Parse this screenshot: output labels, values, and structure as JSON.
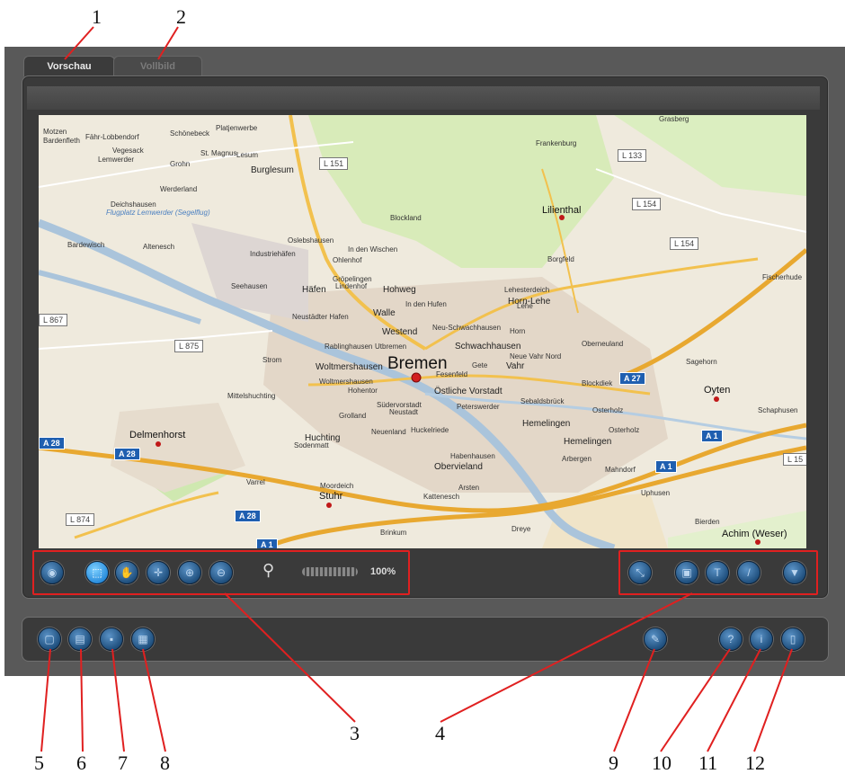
{
  "tabs": [
    {
      "label": "Vorschau",
      "active": true
    },
    {
      "label": "Vollbild",
      "active": false
    }
  ],
  "callouts": [
    "1",
    "2",
    "3",
    "4",
    "5",
    "6",
    "7",
    "8",
    "9",
    "10",
    "11",
    "12"
  ],
  "map": {
    "labels": {
      "bremen": "Bremen",
      "delmenhorst": "Delmenhorst",
      "lilienthal": "Lilienthal",
      "oyten": "Oyten",
      "achim": "Achim (Weser)",
      "stuhr": "Stuhr",
      "burglesum": "Burglesum",
      "blockland": "Blockland",
      "frankenburg": "Frankenburg",
      "grasberg": "Grasberg",
      "motzen": "Motzen",
      "bardenfleth": "Bardenfleth",
      "farge": "Fähr-Lobbendorf",
      "vegesack": "Vegesack",
      "lemwerder": "Lemwerder",
      "grohn": "Grohn",
      "werderland": "Werderland",
      "schoenebeck": "Schönebeck",
      "platjenwerbe": "Platjenwerbe",
      "stmagnus": "St. Magnus",
      "lesum": "Lesum",
      "deichshausen": "Deichshausen",
      "flugplatz": "Flugplatz Lemwerder (Segelflug)",
      "bardewisch": "Bardewisch",
      "altenesch": "Altenesch",
      "industriehafen": "Industriehäfen",
      "oslebshausen": "Oslebshausen",
      "indenwischen": "In den Wischen",
      "ohlenhof": "Ohlenhof",
      "seehausen": "Seehausen",
      "groepelingen": "Gröpelingen",
      "lindenhof": "Lindenhof",
      "haefen": "Häfen",
      "hohweg": "Hohweg",
      "indenhufen": "In den Hufen",
      "lehesterdeich": "Lehesterdeich",
      "hornlehe": "Horn-Lehe",
      "borgfeld": "Borgfeld",
      "fischerhude": "Fischerhude",
      "neustaedterhafen": "Neustädter Hafen",
      "walle": "Walle",
      "westend": "Westend",
      "neuschwachhausen": "Neu-Schwachhausen",
      "horn": "Horn",
      "lehe": "Lehe",
      "oberneuland": "Oberneuland",
      "rablinghausen": "Rablinghausen",
      "utbremen": "Utbremen",
      "schwachhausen": "Schwachhausen",
      "strom": "Strom",
      "woltmershausen": "Woltmershausen",
      "woltmershausen2": "Woltmershausen",
      "fesenfeld": "Fesenfeld",
      "gete": "Gete",
      "vahr": "Vahr",
      "neuevahrnord": "Neue Vahr Nord",
      "blockdiek": "Blockdiek",
      "sagehorn": "Sagehorn",
      "hohentor": "Hohentor",
      "oestlichevorstadt": "Östliche Vorstadt",
      "sebaldsbrueck": "Sebaldsbrück",
      "osterholz": "Osterholz",
      "schaphusen": "Schaphusen",
      "mittelshuchting": "Mittelshuchting",
      "grolland": "Grolland",
      "suedervorstadt": "Südervorstadt",
      "neustadt": "Neustadt",
      "peterswerder": "Peterswerder",
      "hemelingen": "Hemelingen",
      "osterholz2": "Osterholz",
      "huchting": "Huchting",
      "sodenmatt": "Sodenmatt",
      "neuenland": "Neuenland",
      "huckelriede": "Huckelriede",
      "hemelingen2": "Hemelingen",
      "habenhausen": "Habenhausen",
      "arbergen": "Arbergen",
      "mahndorf": "Mahndorf",
      "obervieland": "Obervieland",
      "varrel": "Varrel",
      "moordeich": "Moordeich",
      "arsten": "Arsten",
      "kattenesch": "Kattenesch",
      "uphusen": "Uphusen",
      "bierden": "Bierden",
      "brinkum": "Brinkum",
      "dreye": "Dreye"
    },
    "shields": {
      "l151": "L 151",
      "l133": "L 133",
      "l154a": "L 154",
      "l154b": "L 154",
      "l867": "L 867",
      "l875": "L 875",
      "l874": "L 874",
      "l15": "L 15"
    },
    "autobahn": {
      "a27": "A 27",
      "a28a": "A 28",
      "a28b": "A 28",
      "a28c": "A 28",
      "a1a": "A 1",
      "a1b": "A 1",
      "a1c": "A 1"
    }
  },
  "toolbar": {
    "zoom_label": "100%",
    "zoom_level": 1.0
  },
  "colors": {
    "highlight": "#e02020",
    "button": "#2a6aa6",
    "button_active": "#3aa3ee",
    "frame": "#595959",
    "panel": "#3a3a3a"
  }
}
